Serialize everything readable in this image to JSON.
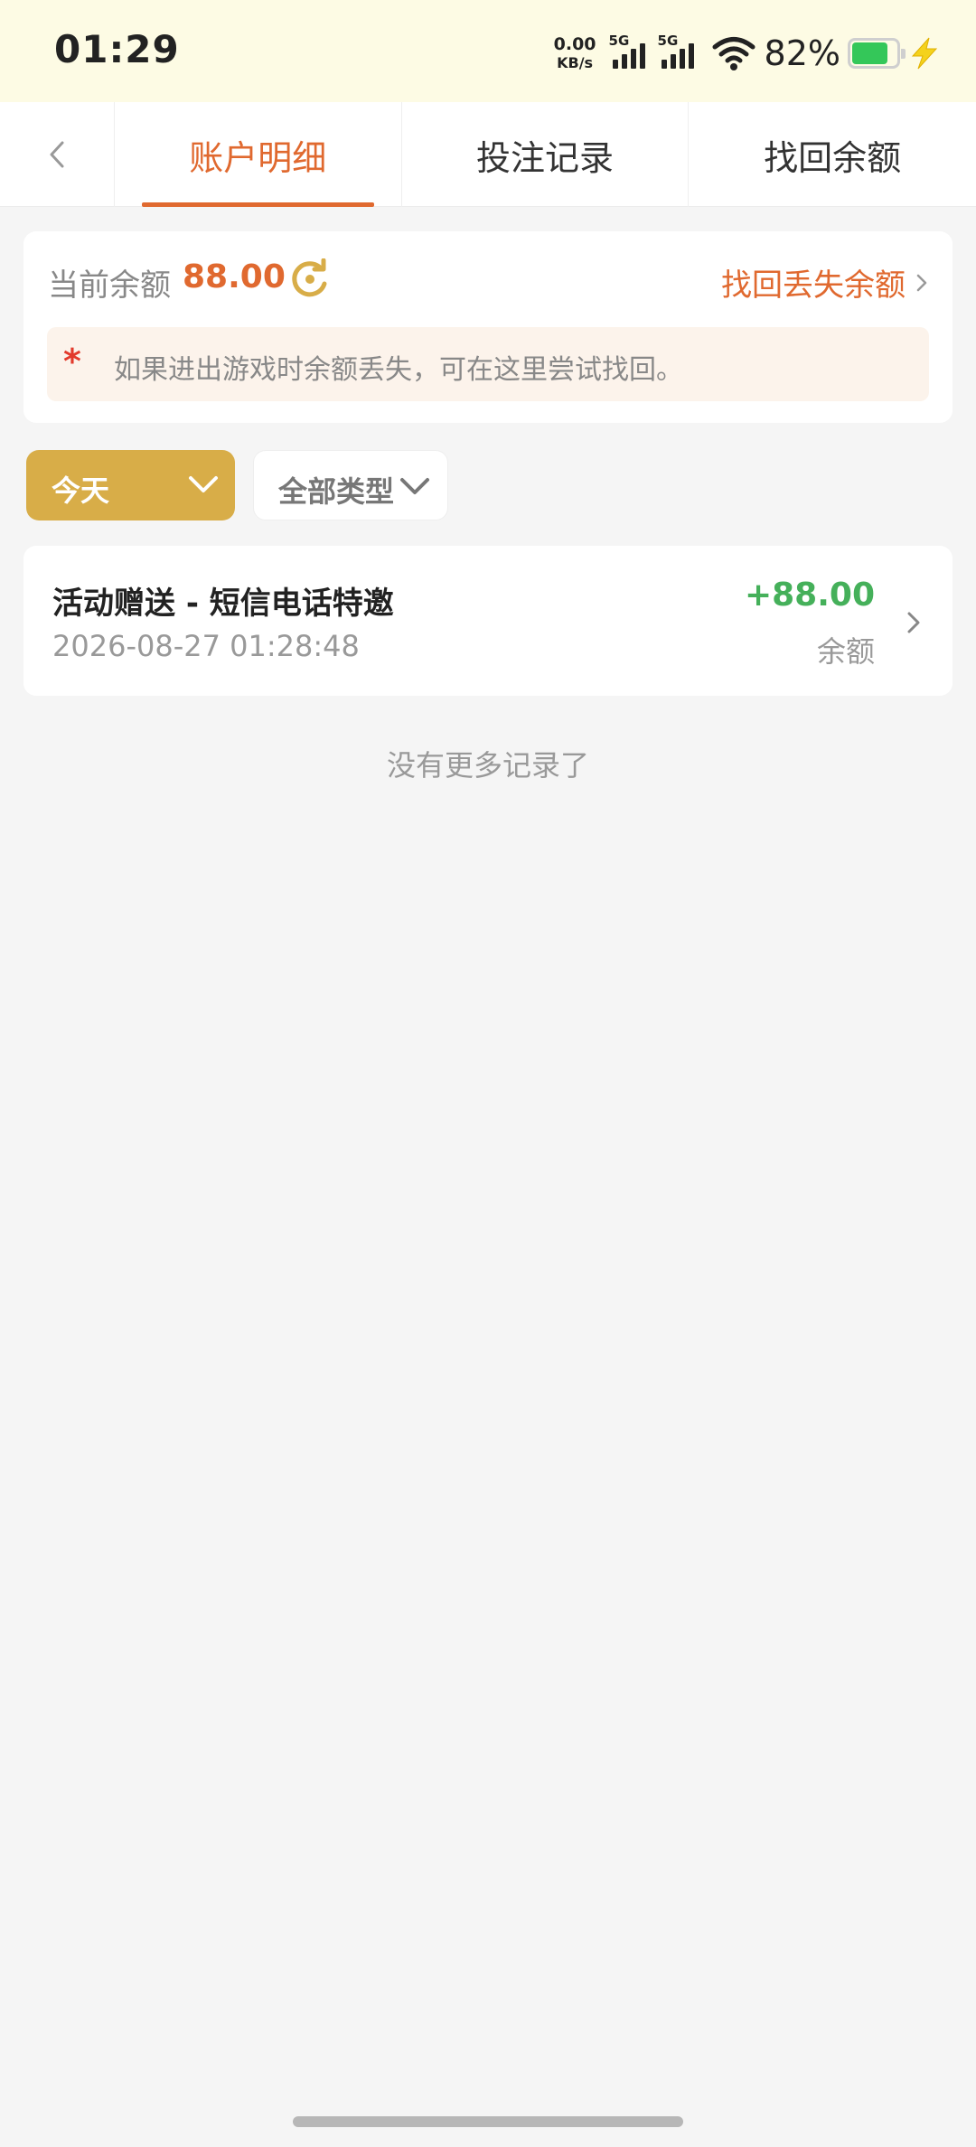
{
  "status_bar": {
    "time": "01:29",
    "net_speed_value": "0.00",
    "net_speed_unit": "KB/s",
    "sim1_label": "5G",
    "sim2_label": "5G",
    "battery_percent": "82%",
    "battery_level": 0.82,
    "battery_color": "#34c759"
  },
  "tabs": [
    {
      "label": "账户明细",
      "active": true
    },
    {
      "label": "投注记录",
      "active": false
    },
    {
      "label": "找回余额",
      "active": false
    }
  ],
  "balance": {
    "label": "当前余额",
    "value": "88.00",
    "recover_link": "找回丢失余额",
    "notice_star": "*",
    "notice_text": "如果进出游戏时余额丢失，可在这里尝试找回。"
  },
  "filters": {
    "date": "今天",
    "type": "全部类型"
  },
  "records": [
    {
      "title": "活动赠送 - 短信电话特邀",
      "time": "2026-08-27 01:28:48",
      "amount": "+88.00",
      "type": "余额"
    }
  ],
  "footer": {
    "no_more": "没有更多记录了"
  },
  "colors": {
    "accent": "#e0692f",
    "gold": "#d8ad48",
    "positive": "#45b05a",
    "status_bg": "#fdfbe4"
  }
}
